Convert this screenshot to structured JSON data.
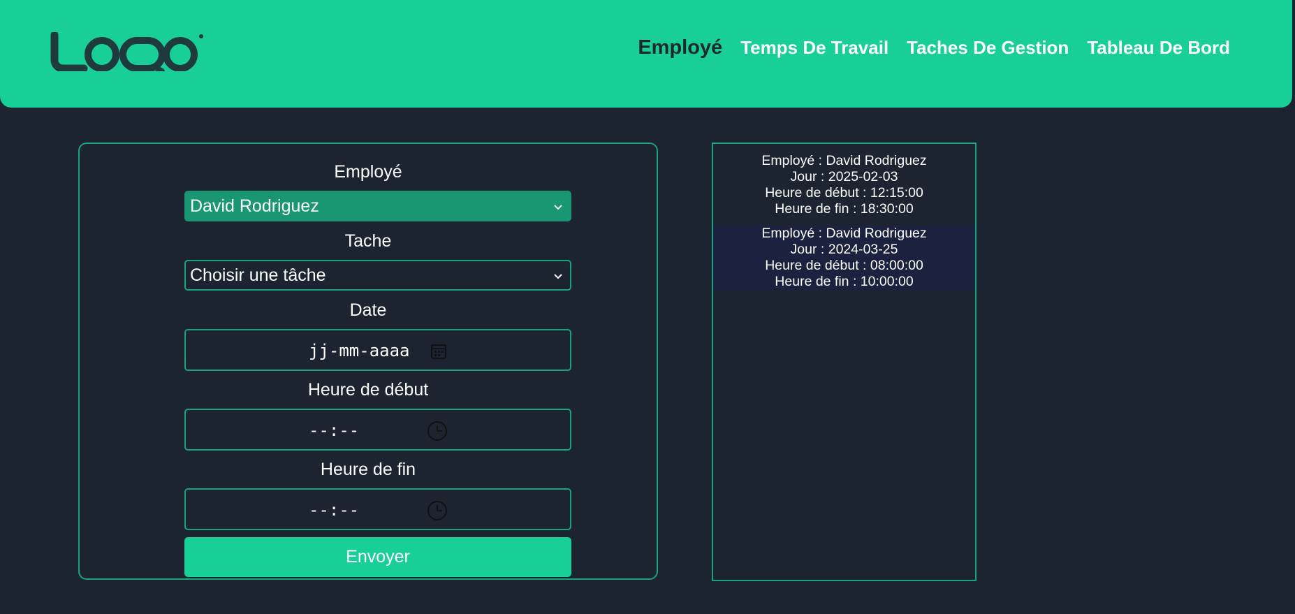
{
  "header": {
    "logo_text": "LOQO",
    "nav": [
      {
        "label": "Employé",
        "active": true
      },
      {
        "label": "Temps De Travail",
        "active": false
      },
      {
        "label": "Taches De Gestion",
        "active": false
      },
      {
        "label": "Tableau De Bord",
        "active": false
      }
    ]
  },
  "form": {
    "employee_label": "Employé",
    "employee_value": "David Rodriguez",
    "task_label": "Tache",
    "task_value": "Choisir une tâche",
    "date_label": "Date",
    "date_placeholder": "jj-mm-aaaa",
    "start_label": "Heure de début",
    "start_placeholder": "--:--",
    "end_label": "Heure de fin",
    "end_placeholder": "--:--",
    "submit_label": "Envoyer"
  },
  "records": [
    {
      "employee": "Employé : David Rodriguez",
      "day": "Jour : 2025-02-03",
      "start": "Heure de début : 12:15:00",
      "end": "Heure de fin : 18:30:00"
    },
    {
      "employee": "Employé : David Rodriguez",
      "day": "Jour : 2024-03-25",
      "start": "Heure de début : 08:00:00",
      "end": "Heure de fin : 10:00:00"
    }
  ],
  "colors": {
    "accent": "#17cf97",
    "background": "#1c2331",
    "border": "#17a57d",
    "selected_field": "#199772",
    "record_highlight": "#1b2240",
    "active_nav": "#1c2a2f"
  },
  "icons": {
    "date_picker": "calendar-icon",
    "time_picker": "clock-icon",
    "select": "chevron-down-icon"
  }
}
